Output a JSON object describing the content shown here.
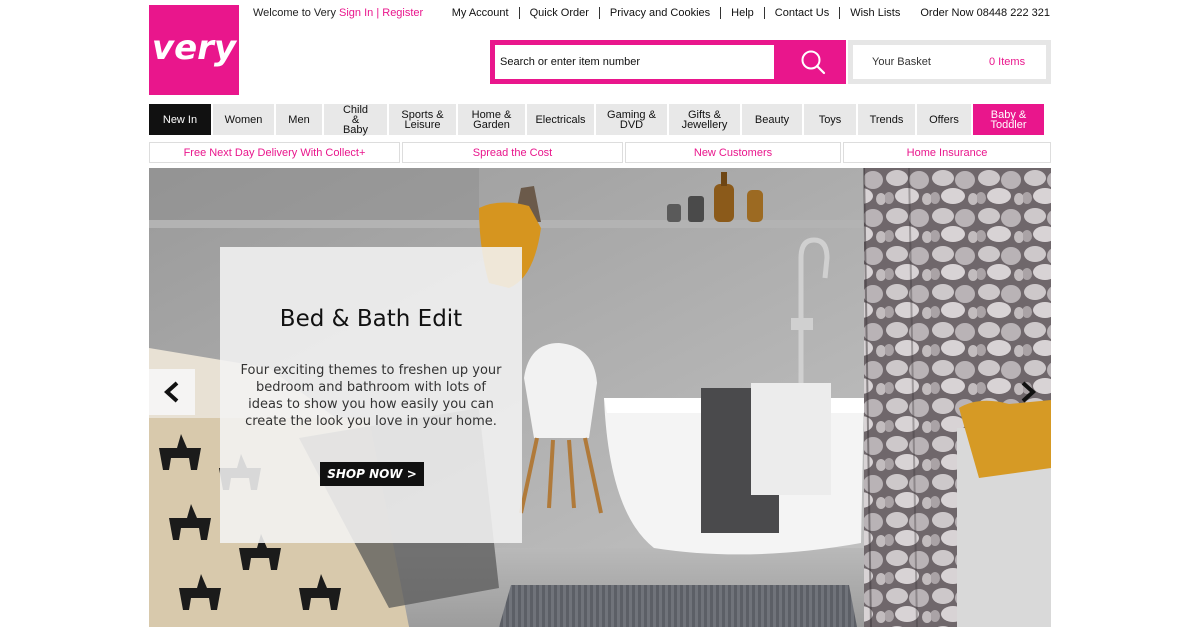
{
  "brand": {
    "logo_text": "very",
    "color": "#e9168c"
  },
  "welcome": {
    "text": "Welcome to Very",
    "sign_in": "Sign In",
    "separator": "|",
    "register": "Register"
  },
  "top_links": [
    "My Account",
    "Quick Order",
    "Privacy and Cookies",
    "Help",
    "Contact Us",
    "Wish Lists"
  ],
  "order_now": "Order Now 08448 222 321",
  "search": {
    "placeholder": "Search or enter item number",
    "icon": "search-icon"
  },
  "basket": {
    "label": "Your Basket",
    "count": "0 Items"
  },
  "nav": [
    {
      "label": "New In",
      "state": "active"
    },
    {
      "label": "Women"
    },
    {
      "label": "Men"
    },
    {
      "label": "Child & Baby"
    },
    {
      "label": "Sports & Leisure"
    },
    {
      "label": "Home & Garden"
    },
    {
      "label": "Electricals"
    },
    {
      "label": "Gaming & DVD"
    },
    {
      "label": "Gifts & Jewellery"
    },
    {
      "label": "Beauty"
    },
    {
      "label": "Toys"
    },
    {
      "label": "Trends"
    },
    {
      "label": "Offers"
    },
    {
      "label": "Baby & Toddler",
      "state": "highlight"
    }
  ],
  "promos": [
    "Free Next Day Delivery With Collect+",
    "Spread the Cost",
    "New Customers",
    "Home Insurance"
  ],
  "hero": {
    "title": "Bed & Bath Edit",
    "text": "Four exciting themes to freshen up your bedroom and bathroom with lots of ideas to show you how easily you can create the look you love in your home.",
    "cta": "SHOP NOW >",
    "prev_icon": "chevron-left-icon",
    "next_icon": "chevron-right-icon"
  }
}
